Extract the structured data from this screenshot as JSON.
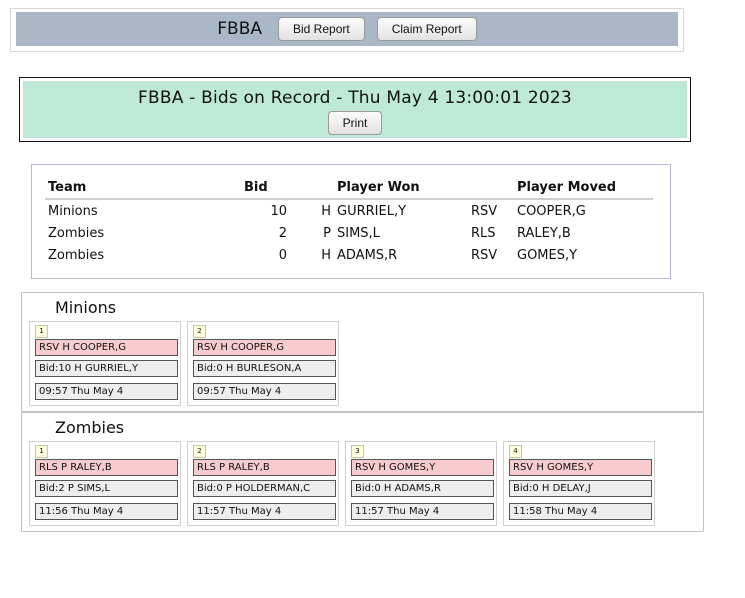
{
  "nav": {
    "title": "FBBA",
    "bid_report_label": "Bid Report",
    "claim_report_label": "Claim Report"
  },
  "header": {
    "title": "FBBA - Bids on Record - Thu May 4 13:00:01 2023",
    "print_label": "Print"
  },
  "bids_table": {
    "columns": [
      "Team",
      "Bid",
      "",
      "Player Won",
      "",
      "Player Moved"
    ],
    "rows": [
      {
        "team": "Minions",
        "bid": "10",
        "pos": "H",
        "won": "GURRIEL,Y",
        "action": "RSV",
        "moved": "COOPER,G"
      },
      {
        "team": "Zombies",
        "bid": "2",
        "pos": "P",
        "won": "SIMS,L",
        "action": "RLS",
        "moved": "RALEY,B"
      },
      {
        "team": "Zombies",
        "bid": "0",
        "pos": "H",
        "won": "ADAMS,R",
        "action": "RSV",
        "moved": "GOMES,Y"
      }
    ]
  },
  "teams": [
    {
      "name": "Minions",
      "cards": [
        {
          "num": "1",
          "move": "RSV H COOPER,G",
          "bid": "Bid:10 H GURRIEL,Y",
          "time": "09:57 Thu May 4"
        },
        {
          "num": "2",
          "move": "RSV H COOPER,G",
          "bid": "Bid:0 H BURLESON,A",
          "time": "09:57 Thu May 4"
        }
      ]
    },
    {
      "name": "Zombies",
      "cards": [
        {
          "num": "1",
          "move": "RLS P RALEY,B",
          "bid": "Bid:2 P SIMS,L",
          "time": "11:56 Thu May 4"
        },
        {
          "num": "2",
          "move": "RLS P RALEY,B",
          "bid": "Bid:0 P HOLDERMAN,C",
          "time": "11:57 Thu May 4"
        },
        {
          "num": "3",
          "move": "RSV H GOMES,Y",
          "bid": "Bid:0 H ADAMS,R",
          "time": "11:57 Thu May 4"
        },
        {
          "num": "4",
          "move": "RSV H GOMES,Y",
          "bid": "Bid:0 H DELAY,J",
          "time": "11:58 Thu May 4"
        }
      ]
    }
  ],
  "colors": {
    "nav_bg": "#a9b7c6",
    "header_bg": "#bde9d6",
    "move_bg": "#f8cbcf",
    "bid_bg": "#eeeeee"
  }
}
